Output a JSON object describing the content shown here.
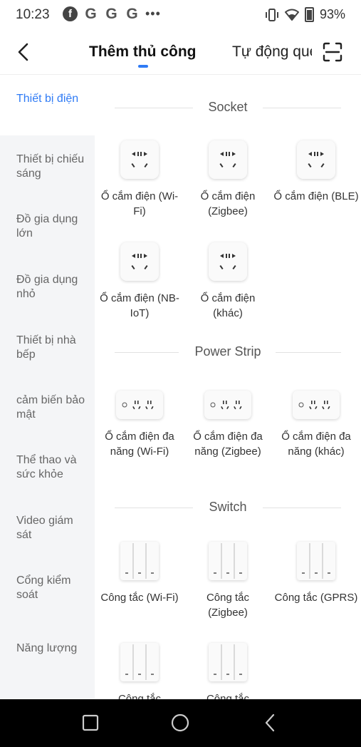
{
  "status": {
    "time": "10:23",
    "battery": "93%",
    "notif_icons": [
      "facebook-icon",
      "google-icon",
      "google-icon",
      "google-icon"
    ],
    "more": "•••"
  },
  "header": {
    "tab_active": "Thêm thủ công",
    "tab_inactive": "Tự động quét",
    "accent": "#2f7bf5"
  },
  "sidebar": {
    "items": [
      {
        "label": "Thiết bị điện"
      },
      {
        "label": "Thiết bị chiếu sáng"
      },
      {
        "label": "Đồ gia dụng lớn"
      },
      {
        "label": "Đồ gia dụng nhỏ"
      },
      {
        "label": "Thiết bị nhà bếp"
      },
      {
        "label": "cảm biến bảo mật"
      },
      {
        "label": "Thể thao và sức khỏe"
      },
      {
        "label": "Video giám sát"
      },
      {
        "label": "Cổng kiểm soát"
      },
      {
        "label": "Năng lượng"
      }
    ]
  },
  "sections": {
    "socket": {
      "title": "Socket",
      "items": [
        {
          "label": "Ổ cắm điện (Wi-Fi)"
        },
        {
          "label": "Ổ cắm điện (Zigbee)"
        },
        {
          "label": "Ổ cắm điện (BLE)"
        },
        {
          "label": "Ổ cắm điện (NB-IoT)"
        },
        {
          "label": "Ổ cắm điện (khác)"
        }
      ]
    },
    "strip": {
      "title": "Power Strip",
      "items": [
        {
          "label": "Ổ cắm điện đa năng (Wi-Fi)"
        },
        {
          "label": "Ổ cắm điện đa năng (Zigbee)"
        },
        {
          "label": "Ổ cắm điện đa năng (khác)"
        }
      ]
    },
    "switch": {
      "title": "Switch",
      "items": [
        {
          "label": "Công tắc (Wi-Fi)"
        },
        {
          "label": "Công tắc (Zigbee)"
        },
        {
          "label": "Công tắc (GPRS)"
        },
        {
          "label": "Công tắc"
        },
        {
          "label": "Công tắc"
        }
      ]
    }
  }
}
